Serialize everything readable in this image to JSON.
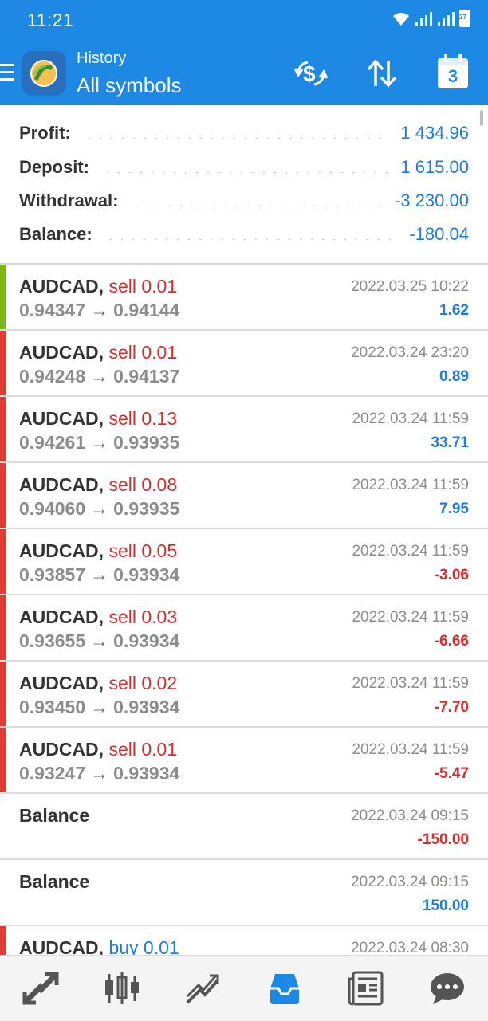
{
  "status_bar": {
    "time": "11:21",
    "battery": "27"
  },
  "app_bar": {
    "subtitle": "History",
    "title": "All symbols",
    "calendar_day": "3"
  },
  "summary": [
    {
      "label": "Profit:",
      "value": "1 434.96"
    },
    {
      "label": "Deposit:",
      "value": "1 615.00"
    },
    {
      "label": "Withdrawal:",
      "value": "-3 230.00"
    },
    {
      "label": "Balance:",
      "value": "-180.04"
    }
  ],
  "deals": [
    {
      "symbol": "AUDCAD,",
      "side": "sell 0.01",
      "open": "0.94347",
      "close": "0.94144",
      "time": "2022.03.25 10:22",
      "profit": "1.62",
      "bar": "#7cb518"
    },
    {
      "symbol": "AUDCAD,",
      "side": "sell 0.01",
      "open": "0.94248",
      "close": "0.94137",
      "time": "2022.03.24 23:20",
      "profit": "0.89",
      "bar": "#e53935"
    },
    {
      "symbol": "AUDCAD,",
      "side": "sell 0.13",
      "open": "0.94261",
      "close": "0.93935",
      "time": "2022.03.24 11:59",
      "profit": "33.71",
      "bar": "#e53935"
    },
    {
      "symbol": "AUDCAD,",
      "side": "sell 0.08",
      "open": "0.94060",
      "close": "0.93935",
      "time": "2022.03.24 11:59",
      "profit": "7.95",
      "bar": "#e53935"
    },
    {
      "symbol": "AUDCAD,",
      "side": "sell 0.05",
      "open": "0.93857",
      "close": "0.93934",
      "time": "2022.03.24 11:59",
      "profit": "-3.06",
      "bar": "#e53935"
    },
    {
      "symbol": "AUDCAD,",
      "side": "sell 0.03",
      "open": "0.93655",
      "close": "0.93934",
      "time": "2022.03.24 11:59",
      "profit": "-6.66",
      "bar": "#e53935"
    },
    {
      "symbol": "AUDCAD,",
      "side": "sell 0.02",
      "open": "0.93450",
      "close": "0.93934",
      "time": "2022.03.24 11:59",
      "profit": "-7.70",
      "bar": "#e53935"
    },
    {
      "symbol": "AUDCAD,",
      "side": "sell 0.01",
      "open": "0.93247",
      "close": "0.93934",
      "time": "2022.03.24 11:59",
      "profit": "-5.47",
      "bar": "#e53935"
    }
  ],
  "balance_ops": [
    {
      "label": "Balance",
      "time": "2022.03.24 09:15",
      "amount": "-150.00"
    },
    {
      "label": "Balance",
      "time": "2022.03.24 09:15",
      "amount": "150.00"
    }
  ],
  "partial_deal": {
    "symbol": "AUDCAD,",
    "side": "buy 0.01",
    "time": "2022.03.24 08:30",
    "bar": "#e53935"
  },
  "arrow_glyph": "→",
  "colors": {
    "accent": "#1e88e5",
    "profit": "#1e7be0",
    "loss": "#d32f2f",
    "sell": "#d32f2f",
    "buy": "#1e7be0",
    "active_nav": "#1e88e5"
  },
  "nav_items": [
    "quotes-icon",
    "chart-icon",
    "trade-icon",
    "history-icon",
    "news-icon",
    "chat-icon"
  ],
  "active_nav": "history-icon"
}
